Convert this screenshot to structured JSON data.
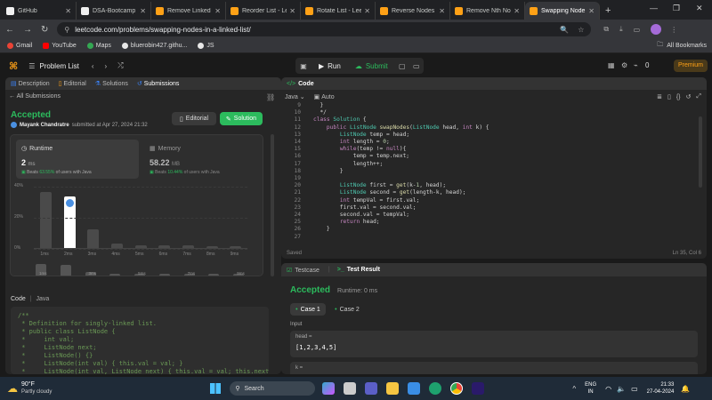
{
  "browser": {
    "tabs": [
      {
        "label": "GitHub",
        "color": "#f0f0f0"
      },
      {
        "label": "DSA-Bootcamp",
        "color": "#f0f0f0"
      },
      {
        "label": "Remove Linked L",
        "color": "#ffa116"
      },
      {
        "label": "Reorder List - Lee",
        "color": "#ffa116"
      },
      {
        "label": "Rotate List - Leet",
        "color": "#ffa116"
      },
      {
        "label": "Reverse Nodes i",
        "color": "#ffa116"
      },
      {
        "label": "Remove Nth No",
        "color": "#ffa116"
      },
      {
        "label": "Swapping Node",
        "color": "#ffa116"
      }
    ],
    "url": "leetcode.com/problems/swapping-nodes-in-a-linked-list/",
    "bookmarks": [
      "Gmail",
      "YouTube",
      "Maps",
      "bluerobin427.githu...",
      "JS"
    ],
    "all_bookmarks": "All Bookmarks"
  },
  "header": {
    "problem_list": "Problem List",
    "run": "Run",
    "submit": "Submit",
    "streak": "0",
    "premium": "Premium"
  },
  "left": {
    "tabs": [
      "Description",
      "Editorial",
      "Solutions",
      "Submissions"
    ],
    "all_submissions": "All Submissions",
    "status": "Accepted",
    "author": "Mayank Chandratre",
    "submitted": "submitted at Apr 27, 2024 21:32",
    "editorial_btn": "Editorial",
    "solution_btn": "Solution",
    "runtime_label": "Runtime",
    "runtime_value": "2",
    "runtime_unit": "ms",
    "runtime_beats_prefix": "Beats",
    "runtime_beats": "63.55%",
    "runtime_beats_suffix": "of users with Java",
    "memory_label": "Memory",
    "memory_value": "58.22",
    "memory_unit": "MB",
    "memory_beats_prefix": "Beats",
    "memory_beats": "10.44%",
    "memory_beats_suffix": "of users with Java",
    "code_label": "Code",
    "code_lang": "Java",
    "snippet": [
      "/**",
      " * Definition for singly-linked list.",
      " * public class ListNode {",
      " *     int val;",
      " *     ListNode next;",
      " *     ListNode() {}",
      " *     ListNode(int val) { this.val = val; }",
      " *     ListNode(int val, ListNode next) { this.val = val; this.next = nex"
    ]
  },
  "chart_data": {
    "type": "bar",
    "categories": [
      "1ms",
      "2ms",
      "3ms",
      "4ms",
      "5ms",
      "6ms",
      "7ms",
      "8ms",
      "9ms"
    ],
    "values": [
      36,
      33,
      12,
      3,
      2,
      2,
      2,
      1,
      1
    ],
    "ylim": [
      0,
      40
    ],
    "yticks": [
      "40%",
      "20%",
      "0%"
    ],
    "highlight_index": 1,
    "mini_labels": [
      "1ms",
      "3ms",
      "5ms",
      "7ms",
      "9ms"
    ],
    "highlight_color": "#ffffff",
    "bar_color": "#4a4a4a"
  },
  "editor": {
    "title": "Code",
    "lang": "Java",
    "mode": "Auto",
    "saved": "Saved",
    "cursor": "Ln 35, Col 6",
    "lines": [
      {
        "n": "9",
        "t": "  }"
      },
      {
        "n": "10",
        "t": "  */"
      },
      {
        "n": "11",
        "t": "class Solution {"
      },
      {
        "n": "12",
        "t": "    public ListNode swapNodes(ListNode head, int k) {"
      },
      {
        "n": "13",
        "t": "        ListNode temp = head;"
      },
      {
        "n": "14",
        "t": "        int length = 0;"
      },
      {
        "n": "15",
        "t": "        while(temp != null){"
      },
      {
        "n": "16",
        "t": "            temp = temp.next;"
      },
      {
        "n": "17",
        "t": "            length++;"
      },
      {
        "n": "18",
        "t": "        }"
      },
      {
        "n": "19",
        "t": ""
      },
      {
        "n": "20",
        "t": "        ListNode first = get(k-1, head);"
      },
      {
        "n": "21",
        "t": "        ListNode second = get(length-k, head);"
      },
      {
        "n": "22",
        "t": "        int tempVal = first.val;"
      },
      {
        "n": "23",
        "t": "        first.val = second.val;"
      },
      {
        "n": "24",
        "t": "        second.val = tempVal;"
      },
      {
        "n": "25",
        "t": "        return head;"
      },
      {
        "n": "26",
        "t": "    }"
      },
      {
        "n": "27",
        "t": ""
      }
    ]
  },
  "result": {
    "testcase_tab": "Testcase",
    "result_tab": "Test Result",
    "status": "Accepted",
    "runtime": "Runtime: 0 ms",
    "case1": "Case 1",
    "case2": "Case 2",
    "input_label": "Input",
    "input_name": "head =",
    "input_value": "[1,2,3,4,5]",
    "k_name": "k ="
  },
  "taskbar": {
    "temp": "90°F",
    "weather": "Partly cloudy",
    "search": "Search",
    "lang1": "ENG",
    "lang2": "IN",
    "time": "21:33",
    "date": "27-04-2024"
  }
}
